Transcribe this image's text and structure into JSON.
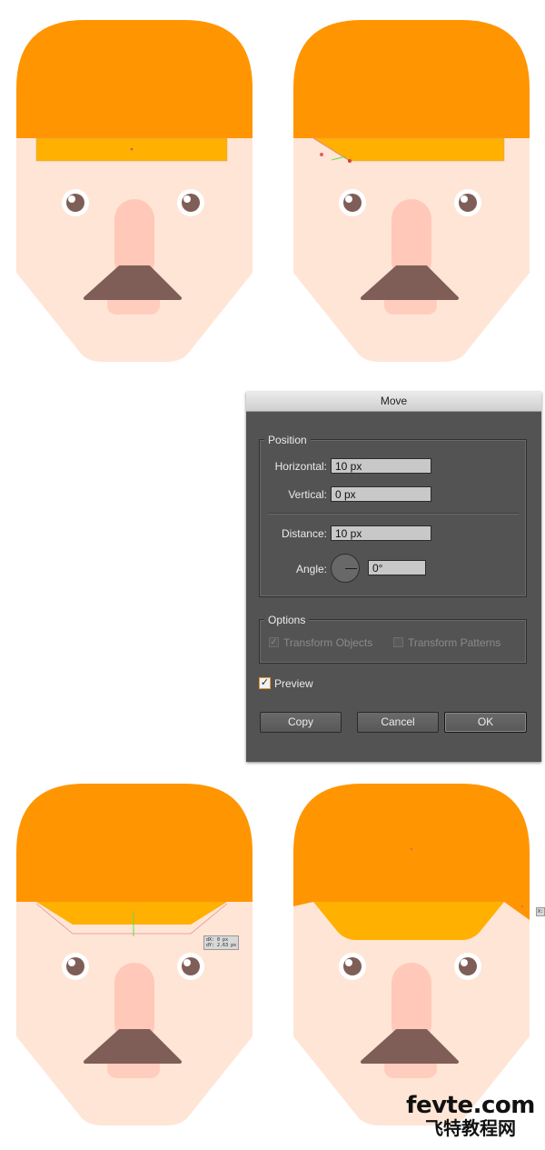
{
  "colors": {
    "hair": "#FF9501",
    "band": "#FFB000",
    "skin": "#FFE5D6",
    "nose": "#FFC8B8",
    "mouth": "#FFCDBD",
    "brown": "#7F5E57",
    "dialog_bg": "#535353",
    "accent": "#E69A2F"
  },
  "dialog": {
    "title": "Move",
    "position_group": "Position",
    "horizontal_label": "Horizontal:",
    "horizontal_value": "10 px",
    "vertical_label": "Vertical:",
    "vertical_value": "0 px",
    "distance_label": "Distance:",
    "distance_value": "10 px",
    "angle_label": "Angle:",
    "angle_value": "0°",
    "options_group": "Options",
    "transform_objects_label": "Transform Objects",
    "transform_objects_checked": true,
    "transform_patterns_label": "Transform Patterns",
    "transform_patterns_checked": false,
    "preview_label": "Preview",
    "preview_checked": true,
    "copy_label": "Copy",
    "cancel_label": "Cancel",
    "ok_label": "OK"
  },
  "faces": {
    "step3_tag_line1": "dX: 0 px",
    "step3_tag_line2": "dY: 2.63 px",
    "step4_tag": "X:"
  },
  "watermark": {
    "line1": "fevte.com",
    "line2": "飞特教程网"
  }
}
